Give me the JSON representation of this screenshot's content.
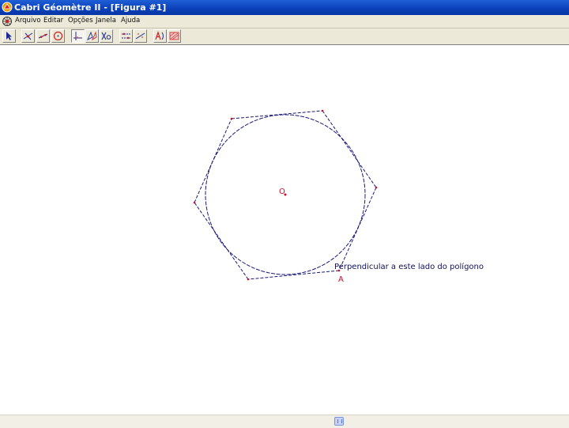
{
  "window": {
    "title": "Cabri Géomètre II - [Figura #1]"
  },
  "menu": {
    "items": [
      "Arquivo",
      "Editar",
      "Opções",
      "Janela",
      "Ajuda"
    ]
  },
  "toolbar": {
    "tools": [
      {
        "name": "pointer-tool-icon"
      },
      {
        "name": "points-tool-icon"
      },
      {
        "name": "lines-tool-icon"
      },
      {
        "name": "curves-tool-icon"
      },
      {
        "name": "construct-tool-icon",
        "active": true
      },
      {
        "name": "transform-tool-icon"
      },
      {
        "name": "macro-tool-icon"
      },
      {
        "name": "check-property-tool-icon"
      },
      {
        "name": "measure-tool-icon"
      },
      {
        "name": "display-tool-icon"
      },
      {
        "name": "draw-tool-icon"
      }
    ]
  },
  "figure": {
    "center_label": "O",
    "point_label": "A",
    "tooltip": "Perpendicular a este lado do polígono"
  },
  "colors": {
    "titlebar": "#0a3fb8",
    "construction_line": "#1a1a7a",
    "point_label": "#c8102e"
  }
}
